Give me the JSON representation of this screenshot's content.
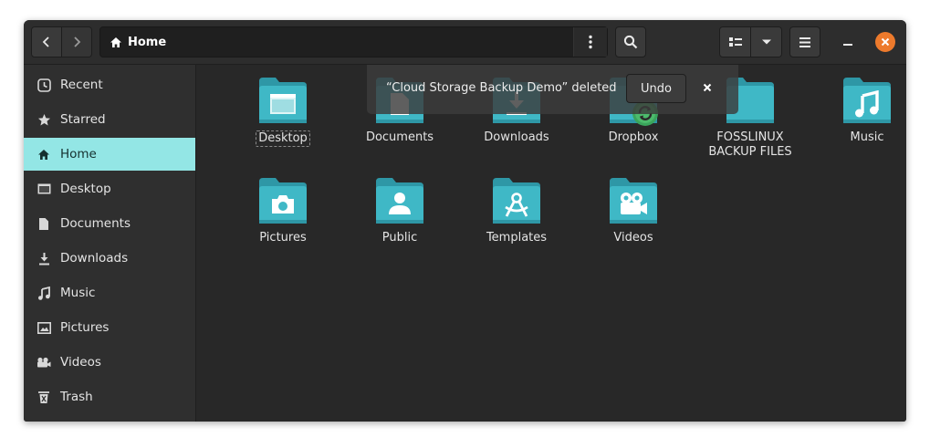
{
  "header": {
    "location": "Home"
  },
  "sidebar": {
    "items": [
      {
        "label": "Recent",
        "icon": "clock-icon"
      },
      {
        "label": "Starred",
        "icon": "star-icon"
      },
      {
        "label": "Home",
        "icon": "home-icon",
        "active": true
      },
      {
        "label": "Desktop",
        "icon": "desktop-icon"
      },
      {
        "label": "Documents",
        "icon": "document-icon"
      },
      {
        "label": "Downloads",
        "icon": "download-icon"
      },
      {
        "label": "Music",
        "icon": "music-icon"
      },
      {
        "label": "Pictures",
        "icon": "picture-icon"
      },
      {
        "label": "Videos",
        "icon": "video-icon"
      },
      {
        "label": "Trash",
        "icon": "trash-icon"
      }
    ]
  },
  "files": [
    {
      "label": "Desktop",
      "emblem": "desktop-icon",
      "selected": true
    },
    {
      "label": "Documents",
      "emblem": "document-icon"
    },
    {
      "label": "Downloads",
      "emblem": "download-icon"
    },
    {
      "label": "Dropbox",
      "emblem": "sync-icon"
    },
    {
      "label": "FOSSLINUX\nBACKUP FILES",
      "emblem": ""
    },
    {
      "label": "Music",
      "emblem": "music-icon"
    },
    {
      "label": "Pictures",
      "emblem": "camera-icon"
    },
    {
      "label": "Public",
      "emblem": "user-icon"
    },
    {
      "label": "Templates",
      "emblem": "compass-icon"
    },
    {
      "label": "Videos",
      "emblem": "video-camera-icon"
    }
  ],
  "toast": {
    "message": "“Cloud Storage Backup Demo” deleted",
    "undo_label": "Undo"
  },
  "colors": {
    "accent": "#93e6e5",
    "folder": "#3fb8c6",
    "folder_dark": "#2e97a6",
    "close": "#ed7a2c"
  }
}
